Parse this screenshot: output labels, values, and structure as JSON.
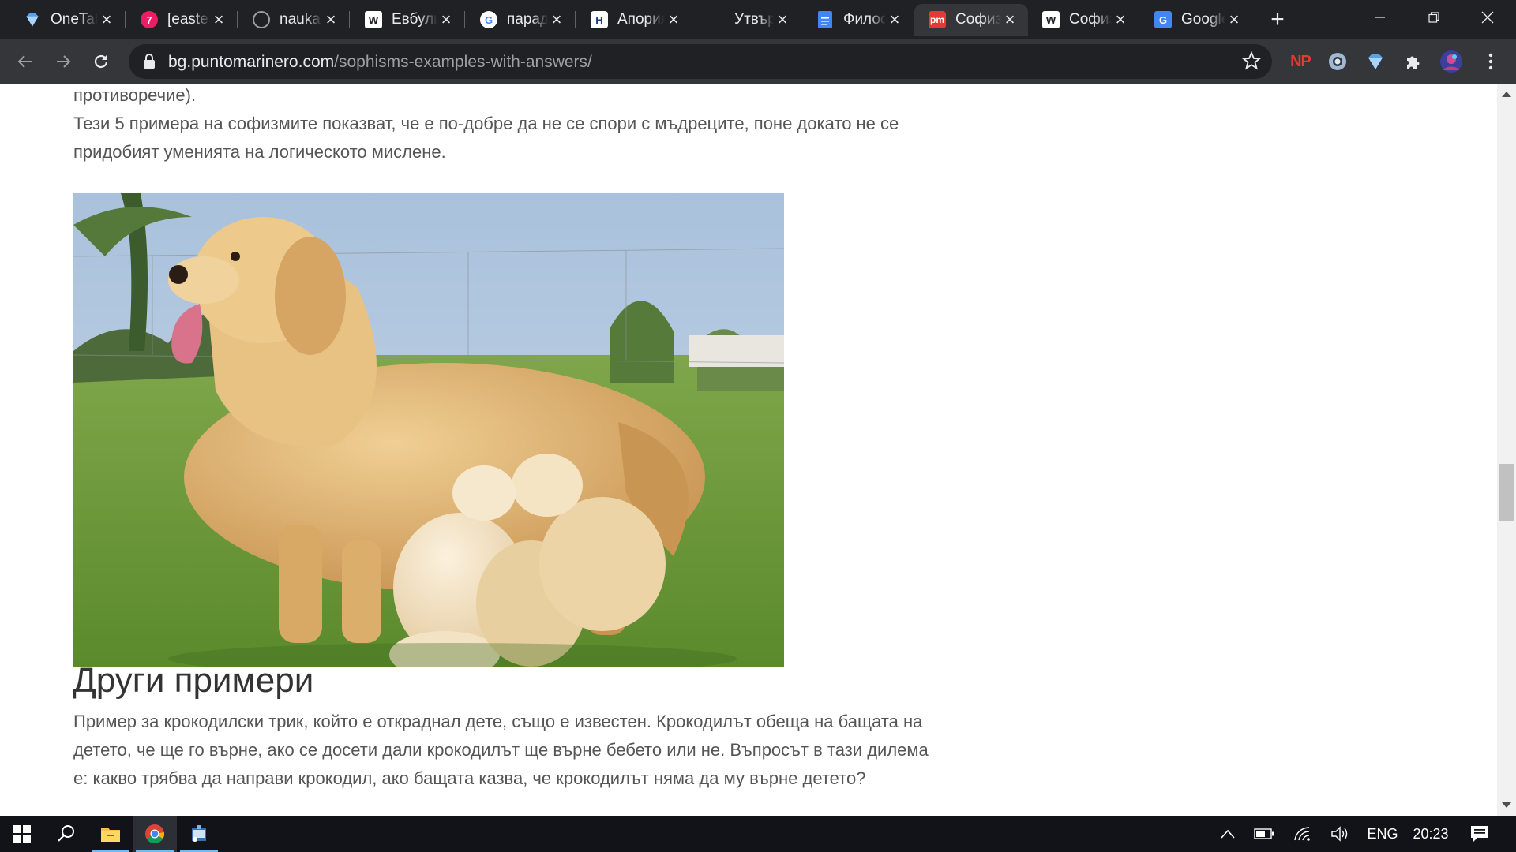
{
  "tabs": [
    {
      "title": "OneTab",
      "icon": "onetab-diamond-icon",
      "color": "#5aa0e8"
    },
    {
      "title": "[easter]",
      "icon": "seven-badge-icon",
      "color": "#e91e63",
      "glyph": "7"
    },
    {
      "title": "nauka",
      "icon": "globe-icon",
      "color": "#9aa0a6"
    },
    {
      "title": "Евбулид",
      "icon": "wikipedia-icon",
      "color": "#ffffff",
      "glyph": "W"
    },
    {
      "title": "парадокс",
      "icon": "google-icon",
      "color": "#ffffff",
      "glyph": "G"
    },
    {
      "title": "Апория",
      "icon": "site-logo-icon",
      "color": "#1d3b8c",
      "glyph": "H"
    },
    {
      "title": "Утвърждение",
      "icon": "blank-icon",
      "color": "#202124"
    },
    {
      "title": "Философия",
      "icon": "google-docs-icon",
      "color": "#4285f4"
    },
    {
      "title": "Софизми",
      "icon": "puntomarinero-icon",
      "color": "#e53935",
      "glyph": "pm"
    },
    {
      "title": "Софизъм",
      "icon": "wikipedia-icon",
      "color": "#ffffff",
      "glyph": "W"
    },
    {
      "title": "Google Translate",
      "icon": "google-translate-icon",
      "color": "#4285f4",
      "glyph": "G"
    }
  ],
  "active_tab_index": 8,
  "address_bar": {
    "domain": "bg.puntomarinero.com",
    "path": "/sophisms-examples-with-answers/"
  },
  "extensions": {
    "np_label": "NP"
  },
  "article": {
    "para1_line1": "противоречие).",
    "para1_line2": "Тези 5 примера на софизмите показват, че е по-добре да не се спори с мъдреците, поне докато не се",
    "para1_line3": "придобият уменията на логическото мислене.",
    "image_alt": "Голдън ретривър кърми кученцата си на поляна",
    "heading": "Други примери",
    "para2_line1": "Пример за крокодилски трик, който е откраднал дете, също е известен. Крокодилът обеща на бащата на",
    "para2_line2": "детето, че ще го върне, ако се досети дали крокодилът ще върне бебето или не. Въпросът в тази дилема",
    "para2_line3": "е: какво трябва да направи крокодил, ако бащата казва, че крокодилът няма да му върне детето?"
  },
  "taskbar": {
    "language": "ENG",
    "time": "20:23"
  },
  "colors": {
    "tabstrip_bg": "#202124",
    "toolbar_bg": "#35363a",
    "text_body": "#555555",
    "heading": "#333333",
    "taskbar_bg": "#111318"
  }
}
